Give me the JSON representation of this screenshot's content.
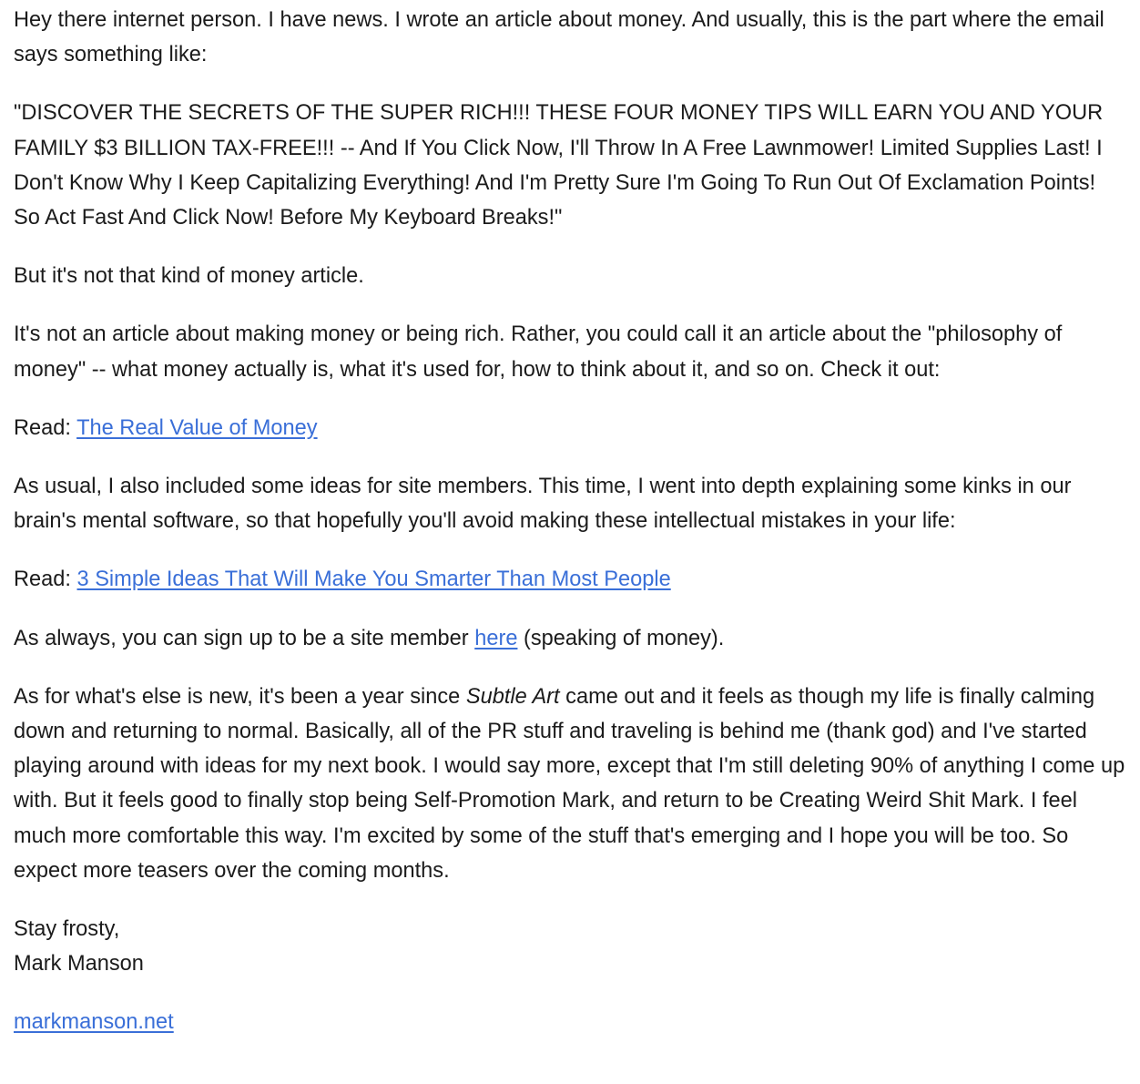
{
  "email": {
    "p1": "Hey there internet person. I have news. I wrote an article about money. And usually, this is the part where the email says something like:",
    "p2": "\"DISCOVER THE SECRETS OF THE SUPER RICH!!! THESE FOUR MONEY TIPS WILL EARN YOU AND YOUR FAMILY $3 BILLION TAX-FREE!!! -- And If You Click Now, I'll Throw In A Free Lawnmower! Limited Supplies Last! I Don't Know Why I Keep Capitalizing Everything! And I'm Pretty Sure I'm Going To Run Out Of Exclamation Points! So Act Fast And Click Now! Before My Keyboard Breaks!\"",
    "p3": "But it's not that kind of money article.",
    "p4": "It's not an article about making money or being rich. Rather, you could call it an article about the \"philosophy of money\" -- what money actually is, what it's used for, how to think about it, and so on. Check it out:",
    "read1": {
      "prefix": "Read: ",
      "link_text": "The Real Value of Money"
    },
    "p5": "As usual, I also included some ideas for site members. This time, I went into depth explaining some kinks in our brain's mental software, so that hopefully you'll avoid making these intellectual mistakes in your life:",
    "read2": {
      "prefix": "Read: ",
      "link_text": "3 Simple Ideas That Will Make You Smarter Than Most People"
    },
    "p6": {
      "before": "As always, you can sign up to be a site member ",
      "link_text": "here",
      "after": " (speaking of money)."
    },
    "p7": {
      "before": "As for what's else is new, it's been a year since ",
      "italic": "Subtle Art",
      "after": " came out and it feels as though my life is finally calming down and returning to normal. Basically, all of the PR stuff and traveling is behind me (thank god) and I've started playing around with ideas for my next book. I would say more, except that I'm still deleting 90% of anything I come up with. But it feels good to finally stop being Self-Promotion Mark, and return to be Creating Weird Shit Mark. I feel much more comfortable this way. I'm excited by some of the stuff that's emerging and I hope you will be too. So expect more teasers over the coming months."
    },
    "signoff": {
      "line1": "Stay frosty,",
      "line2": "Mark Manson"
    },
    "site_link": "markmanson.net"
  },
  "colors": {
    "text": "#1b1b1b",
    "link": "#3a6fd8",
    "background": "#ffffff"
  }
}
